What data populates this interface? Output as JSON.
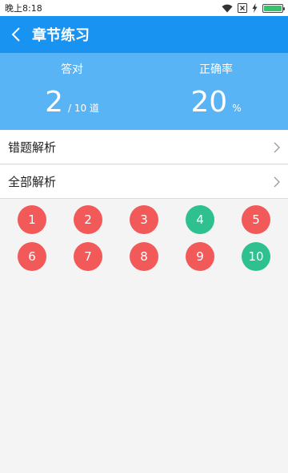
{
  "status_bar": {
    "time": "晚上8:18"
  },
  "header": {
    "title": "章节练习"
  },
  "stats": {
    "correct_label": "答对",
    "correct_value": "2",
    "correct_suffix": "/ 10 道",
    "rate_label": "正确率",
    "rate_value": "20",
    "rate_suffix": "%"
  },
  "menu": [
    {
      "label": "错题解析"
    },
    {
      "label": "全部解析"
    }
  ],
  "questions": [
    {
      "num": "1",
      "status": "wrong"
    },
    {
      "num": "2",
      "status": "wrong"
    },
    {
      "num": "3",
      "status": "wrong"
    },
    {
      "num": "4",
      "status": "correct"
    },
    {
      "num": "5",
      "status": "wrong"
    },
    {
      "num": "6",
      "status": "wrong"
    },
    {
      "num": "7",
      "status": "wrong"
    },
    {
      "num": "8",
      "status": "wrong"
    },
    {
      "num": "9",
      "status": "wrong"
    },
    {
      "num": "10",
      "status": "correct"
    }
  ],
  "colors": {
    "app_bar": "#1993f2",
    "stats_bg": "#58b4f4",
    "wrong": "#f25a5a",
    "correct": "#2fc08f",
    "battery": "#35c46a"
  }
}
